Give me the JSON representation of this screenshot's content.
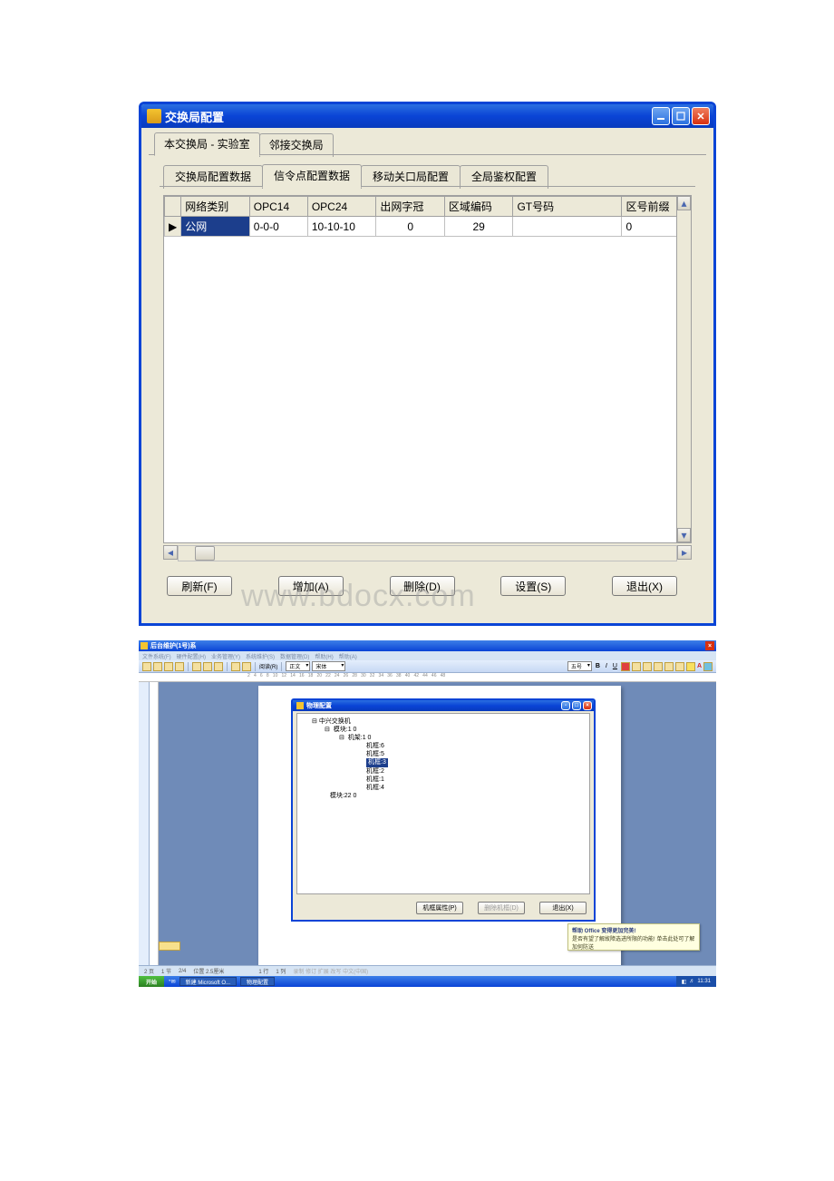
{
  "dialog1": {
    "title": "交换局配置",
    "tabs_level1": [
      {
        "label": "本交换局 - 实验室",
        "active": true
      },
      {
        "label": "邻接交换局",
        "active": false
      }
    ],
    "tabs_level2": [
      {
        "label": "交换局配置数据",
        "active": false
      },
      {
        "label": "信令点配置数据",
        "active": true
      },
      {
        "label": "移动关口局配置",
        "active": false
      },
      {
        "label": "全局鉴权配置",
        "active": false
      }
    ],
    "columns": [
      "网络类别",
      "OPC14",
      "OPC24",
      "出网字冠",
      "区域编码",
      "GT号码",
      "区号前缀"
    ],
    "rows": [
      {
        "c0": "公网",
        "c1": "0-0-0",
        "c2": "10-10-10",
        "c3": "0",
        "c4": "29",
        "c5": "",
        "c6": "0"
      }
    ],
    "buttons": {
      "refresh": "刷新(F)",
      "add": "增加(A)",
      "delete": "删除(D)",
      "set": "设置(S)",
      "exit": "退出(X)"
    },
    "watermark": "www.bdocx.com"
  },
  "shot2": {
    "app_title": "后台维护(1号)系",
    "menus": [
      "文件系统(F)",
      "硬件配置(H)",
      "业务管理(Y)",
      "系统维护(S)",
      "数据管理(D)",
      "帮助(H)",
      "帮助(A)"
    ],
    "toolbar_dropdown1": "正文",
    "toolbar_dropdown2": "宋体",
    "toolbar_dropdown3": "五号",
    "inner_dialog": {
      "title": "物理配置",
      "tree": {
        "root": "中兴交换机",
        "n1": "模块:1    0",
        "n2": "机架:1    0",
        "leaves": [
          "机框:6",
          "机框:5",
          "机框:3",
          "机框:2",
          "机框:1",
          "机框:4"
        ],
        "selected_index": 2,
        "n3": "模块:22    0"
      },
      "buttons": {
        "prop": "机框属性(P)",
        "del": "删除机框(D)",
        "exit": "退出(X)"
      }
    },
    "balloon": {
      "title": "帮助 Office 变得更加完美!",
      "body": "是否有望了解故障选进所限的功能! 单击此处可了解加何防送"
    },
    "status": {
      "page": "2 页",
      "sec": "1 节",
      "pg": "2/4",
      "pos": "位置 2.5厘米",
      "line": "1 行",
      "col": "1 列",
      "flags": "录制 修订 扩展 改写 中文(中国)"
    },
    "taskbar": {
      "start": "开始",
      "btn1": "新建 Microsoft O...",
      "btn2": "物理配置",
      "clock": "11:31"
    }
  }
}
